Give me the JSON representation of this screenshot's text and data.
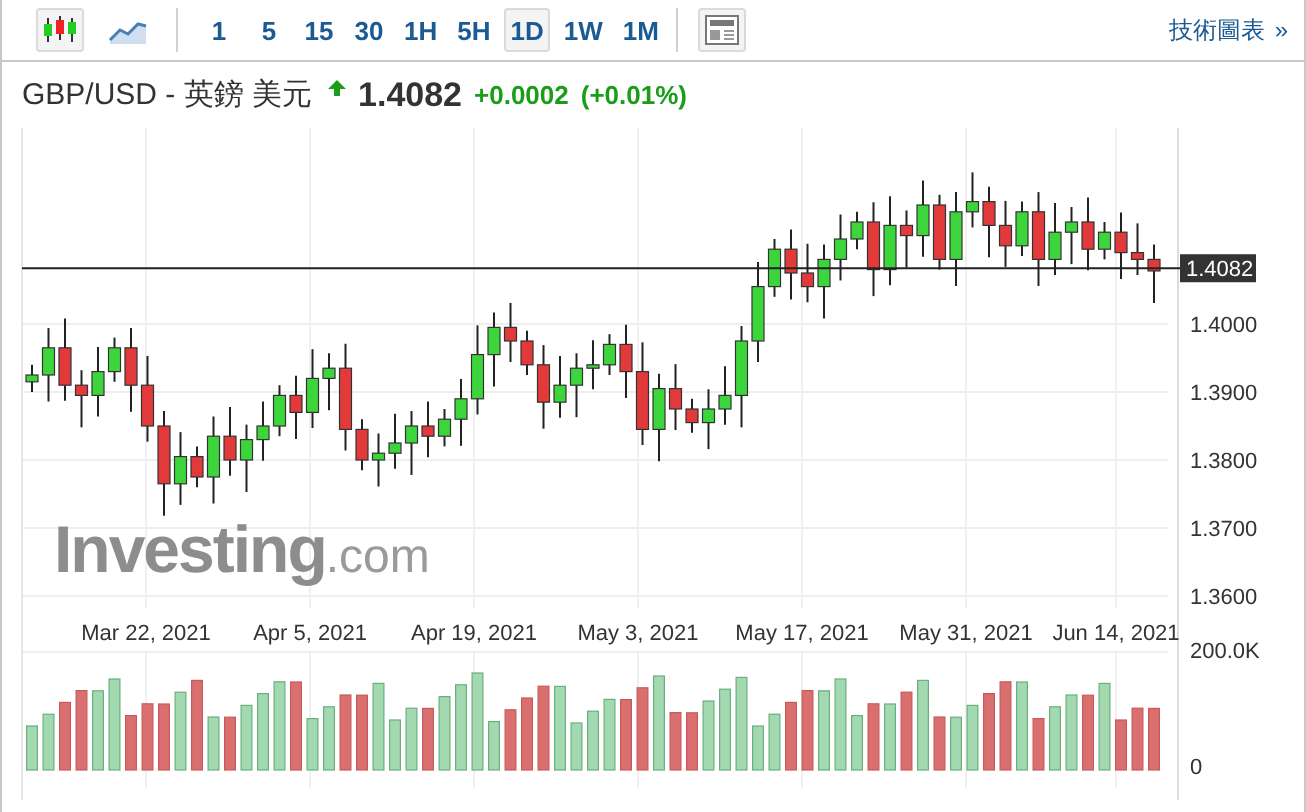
{
  "toolbar": {
    "chart_types": [
      {
        "kind": "candles",
        "selected": true
      },
      {
        "kind": "line",
        "selected": false
      }
    ],
    "intervals": [
      {
        "label": "1",
        "selected": false
      },
      {
        "label": "5",
        "selected": false
      },
      {
        "label": "15",
        "selected": false
      },
      {
        "label": "30",
        "selected": false
      },
      {
        "label": "1H",
        "selected": false
      },
      {
        "label": "5H",
        "selected": false
      },
      {
        "label": "1D",
        "selected": true
      },
      {
        "label": "1W",
        "selected": false
      },
      {
        "label": "1M",
        "selected": false
      }
    ],
    "link": "技術圖表",
    "link_icon": "»"
  },
  "header": {
    "pair": "GBP/USD - 英鎊 美元",
    "rising": true,
    "price": "1.4082",
    "change": "+0.0002",
    "change_pct": "(+0.01%)"
  },
  "chart": {
    "price_labels": [
      "1.4000",
      "1.3900",
      "1.3800",
      "1.3700",
      "1.3600"
    ],
    "current_price": "1.4082",
    "date_labels": [
      "Mar 22, 2021",
      "Apr 5, 2021",
      "Apr 19, 2021",
      "May 3, 2021",
      "May 17, 2021",
      "May 31, 2021",
      "Jun 14, 2021"
    ],
    "volume_labels": [
      "200.0K",
      "0"
    ],
    "logo": {
      "name": "Investing",
      "suffix": ".com"
    }
  }
}
